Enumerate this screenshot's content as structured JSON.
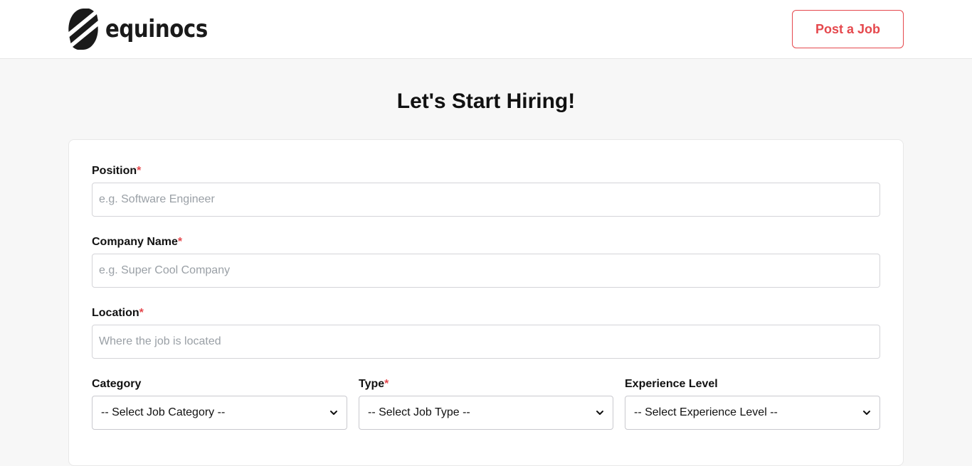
{
  "header": {
    "logo_text": "equinocs",
    "post_job_label": "Post a Job"
  },
  "page": {
    "title": "Let's Start Hiring!"
  },
  "form": {
    "position": {
      "label": "Position",
      "required_mark": "*",
      "placeholder": "e.g. Software Engineer"
    },
    "company": {
      "label": "Company Name",
      "required_mark": "*",
      "placeholder": "e.g. Super Cool Company"
    },
    "location": {
      "label": "Location",
      "required_mark": "*",
      "placeholder": "Where the job is located"
    },
    "category": {
      "label": "Category",
      "selected": "-- Select Job Category --"
    },
    "type": {
      "label": "Type",
      "required_mark": "*",
      "selected": "-- Select Job Type --"
    },
    "experience": {
      "label": "Experience Level",
      "selected": "-- Select Experience Level --"
    }
  },
  "colors": {
    "accent": "#e5484d",
    "page_bg": "#f7f7f7",
    "card_bg": "#ffffff",
    "logo": "#1a1a1a"
  },
  "icons": {
    "logo_mark": "equinocs-logo-icon",
    "select_arrow": "chevron-down-icon"
  }
}
